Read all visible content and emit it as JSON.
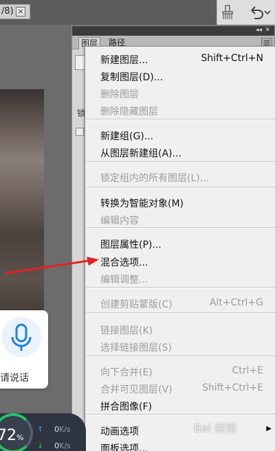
{
  "document_tab": {
    "label": "/8)",
    "close_glyph": "×"
  },
  "history_toolbar": {
    "icons": [
      "brush-icon",
      "undo-icon",
      "chevron-down-icon"
    ]
  },
  "layers_panel": {
    "tabs": [
      {
        "label": "图层",
        "active": true
      },
      {
        "label": "路径",
        "active": false
      }
    ],
    "collapse_glyph": "◂◂",
    "close_glyph": "✕",
    "partial_glyph": "锁"
  },
  "context_menu": {
    "items": [
      {
        "label": "新建图层...",
        "shortcut": "Shift+Ctrl+N",
        "enabled": true
      },
      {
        "label": "复制图层(D)...",
        "shortcut": "",
        "enabled": true
      },
      {
        "label": "删除图层",
        "shortcut": "",
        "enabled": false
      },
      {
        "label": "删除隐藏图层",
        "shortcut": "",
        "enabled": false
      },
      {
        "label": "新建组(G)...",
        "shortcut": "",
        "enabled": true
      },
      {
        "label": "从图层新建组(A)...",
        "shortcut": "",
        "enabled": true
      },
      {
        "label": "锁定组内的所有图层(L)...",
        "shortcut": "",
        "enabled": false
      },
      {
        "label": "转换为智能对象(M)",
        "shortcut": "",
        "enabled": true
      },
      {
        "label": "编辑内容",
        "shortcut": "",
        "enabled": false
      },
      {
        "label": "图层属性(P)...",
        "shortcut": "",
        "enabled": true
      },
      {
        "label": "混合选项...",
        "shortcut": "",
        "enabled": true
      },
      {
        "label": "编辑调整...",
        "shortcut": "",
        "enabled": false
      },
      {
        "label": "创建剪贴蒙版(C)",
        "shortcut": "Alt+Ctrl+G",
        "enabled": false
      },
      {
        "label": "链接图层(K)",
        "shortcut": "",
        "enabled": false
      },
      {
        "label": "选择链接图层(S)",
        "shortcut": "",
        "enabled": false
      },
      {
        "label": "向下合并(E)",
        "shortcut": "Ctrl+E",
        "enabled": false
      },
      {
        "label": "合并可见图层(V)",
        "shortcut": "Shift+Ctrl+E",
        "enabled": false
      },
      {
        "label": "拼合图像(F)",
        "shortcut": "",
        "enabled": true
      },
      {
        "label": "动画选项",
        "shortcut": "",
        "enabled": true,
        "submenu": true
      },
      {
        "label": "面板选项...",
        "shortcut": "",
        "enabled": true
      }
    ]
  },
  "voice_widget": {
    "label": "请说话",
    "icon": "microphone-icon",
    "accent_color": "#1f7fe0"
  },
  "speed_widget": {
    "percent": "72",
    "percent_unit": "%",
    "upload": {
      "value": "0",
      "unit": "K/s"
    },
    "download": {
      "value": "0",
      "unit": "K/s"
    },
    "ring_color": "#23c06a"
  },
  "annotation": {
    "arrow_color": "#e32222",
    "points_to": "混合选项..."
  },
  "watermark": {
    "text": "Bai 经验"
  }
}
